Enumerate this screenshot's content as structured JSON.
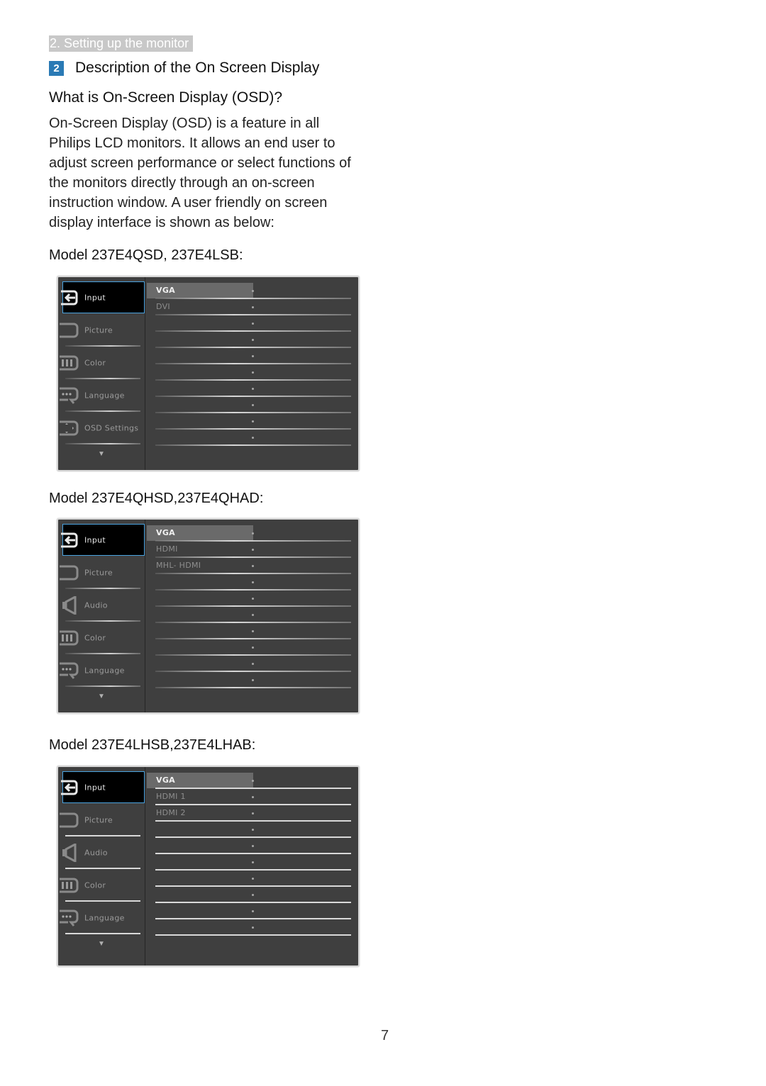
{
  "section_tag": "2. Setting up the monitor",
  "heading": {
    "number": "2",
    "title": "Description of the On Screen Display"
  },
  "subheading": "What is On-Screen Display (OSD)?",
  "body": "On-Screen Display (OSD) is a feature in all Philips LCD monitors. It allows an end user to adjust screen performance or select functions of the monitors directly through an on-screen instruction window. A user friendly on screen display interface is shown as below:",
  "osds": [
    {
      "model_label": "Model 237E4QSD, 237E4LSB:",
      "menu": [
        {
          "label": "Input",
          "icon": "input-icon",
          "selected": true
        },
        {
          "label": "Picture",
          "icon": "picture-icon",
          "selected": false
        },
        {
          "label": "Color",
          "icon": "color-icon",
          "selected": false
        },
        {
          "label": "Language",
          "icon": "language-icon",
          "selected": false
        },
        {
          "label": "OSD Settings",
          "icon": "osd-settings-icon",
          "selected": false
        }
      ],
      "options": [
        "VGA",
        "DVI",
        "",
        "",
        "",
        "",
        "",
        "",
        "",
        ""
      ],
      "selected_option": "VGA",
      "more_indicator": "▼"
    },
    {
      "model_label": "Model 237E4QHSD,237E4QHAD:",
      "menu": [
        {
          "label": "Input",
          "icon": "input-icon",
          "selected": true
        },
        {
          "label": "Picture",
          "icon": "picture-icon",
          "selected": false
        },
        {
          "label": "Audio",
          "icon": "audio-icon",
          "selected": false
        },
        {
          "label": "Color",
          "icon": "color-icon",
          "selected": false
        },
        {
          "label": "Language",
          "icon": "language-icon",
          "selected": false
        }
      ],
      "options": [
        "VGA",
        "HDMI",
        "MHL- HDMI",
        "",
        "",
        "",
        "",
        "",
        "",
        ""
      ],
      "selected_option": "VGA",
      "more_indicator": "▼"
    },
    {
      "model_label": "Model 237E4LHSB,237E4LHAB:",
      "menu": [
        {
          "label": "Input",
          "icon": "input-icon",
          "selected": true
        },
        {
          "label": "Picture",
          "icon": "picture-icon",
          "selected": false
        },
        {
          "label": "Audio",
          "icon": "audio-icon",
          "selected": false
        },
        {
          "label": "Color",
          "icon": "color-icon",
          "selected": false
        },
        {
          "label": "Language",
          "icon": "language-icon",
          "selected": false
        }
      ],
      "options": [
        "VGA",
        "HDMI 1",
        "HDMI 2",
        "",
        "",
        "",
        "",
        "",
        "",
        ""
      ],
      "selected_option": "VGA",
      "more_indicator": "▼"
    }
  ],
  "page_number": "7"
}
